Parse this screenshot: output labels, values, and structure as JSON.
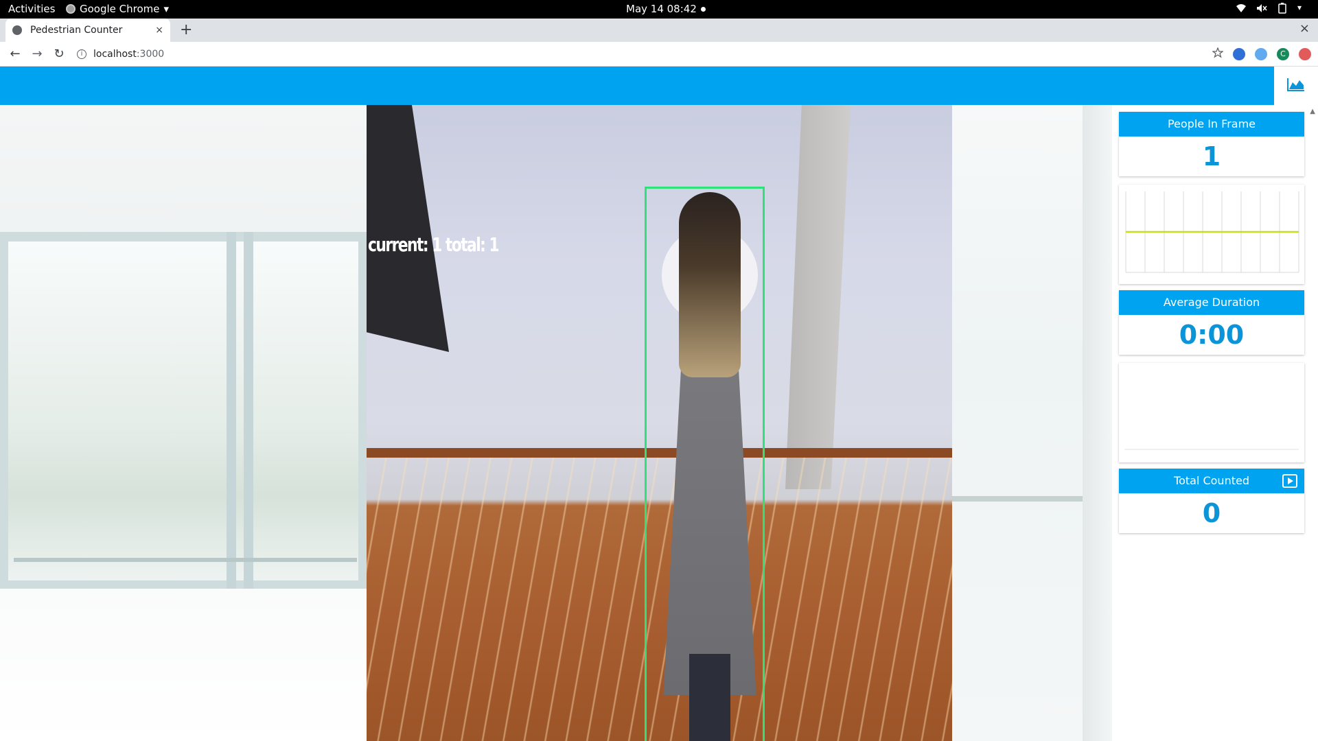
{
  "system": {
    "activities": "Activities",
    "app_menu": "Google Chrome",
    "clock": "May 14  08:42"
  },
  "browser": {
    "tab_title": "Pedestrian Counter",
    "tab_close": "×",
    "new_tab": "+",
    "window_close": "×",
    "url_host": "localhost",
    "url_port": ":3000",
    "profile_initial": "C"
  },
  "video": {
    "overlay_text": "current: 1 total: 1"
  },
  "stats": {
    "people_in_frame": {
      "label": "People In Frame",
      "value": "1"
    },
    "average_duration": {
      "label": "Average Duration",
      "value": "0:00"
    },
    "total_counted": {
      "label": "Total Counted",
      "value": "0"
    }
  },
  "chart_data": {
    "type": "line",
    "series": [
      {
        "values": [
          1,
          1,
          1,
          1,
          1,
          1,
          1,
          1,
          1,
          1
        ]
      }
    ],
    "ylim": [
      0,
      2
    ],
    "grid": true,
    "line_color": "#c6de1e"
  },
  "colors": {
    "accent": "#00a3f0",
    "value_text": "#0c94d9",
    "bbox": "#2de27a"
  },
  "icons": {
    "header_button": "area-chart-icon",
    "total_counted": "play-icon"
  }
}
